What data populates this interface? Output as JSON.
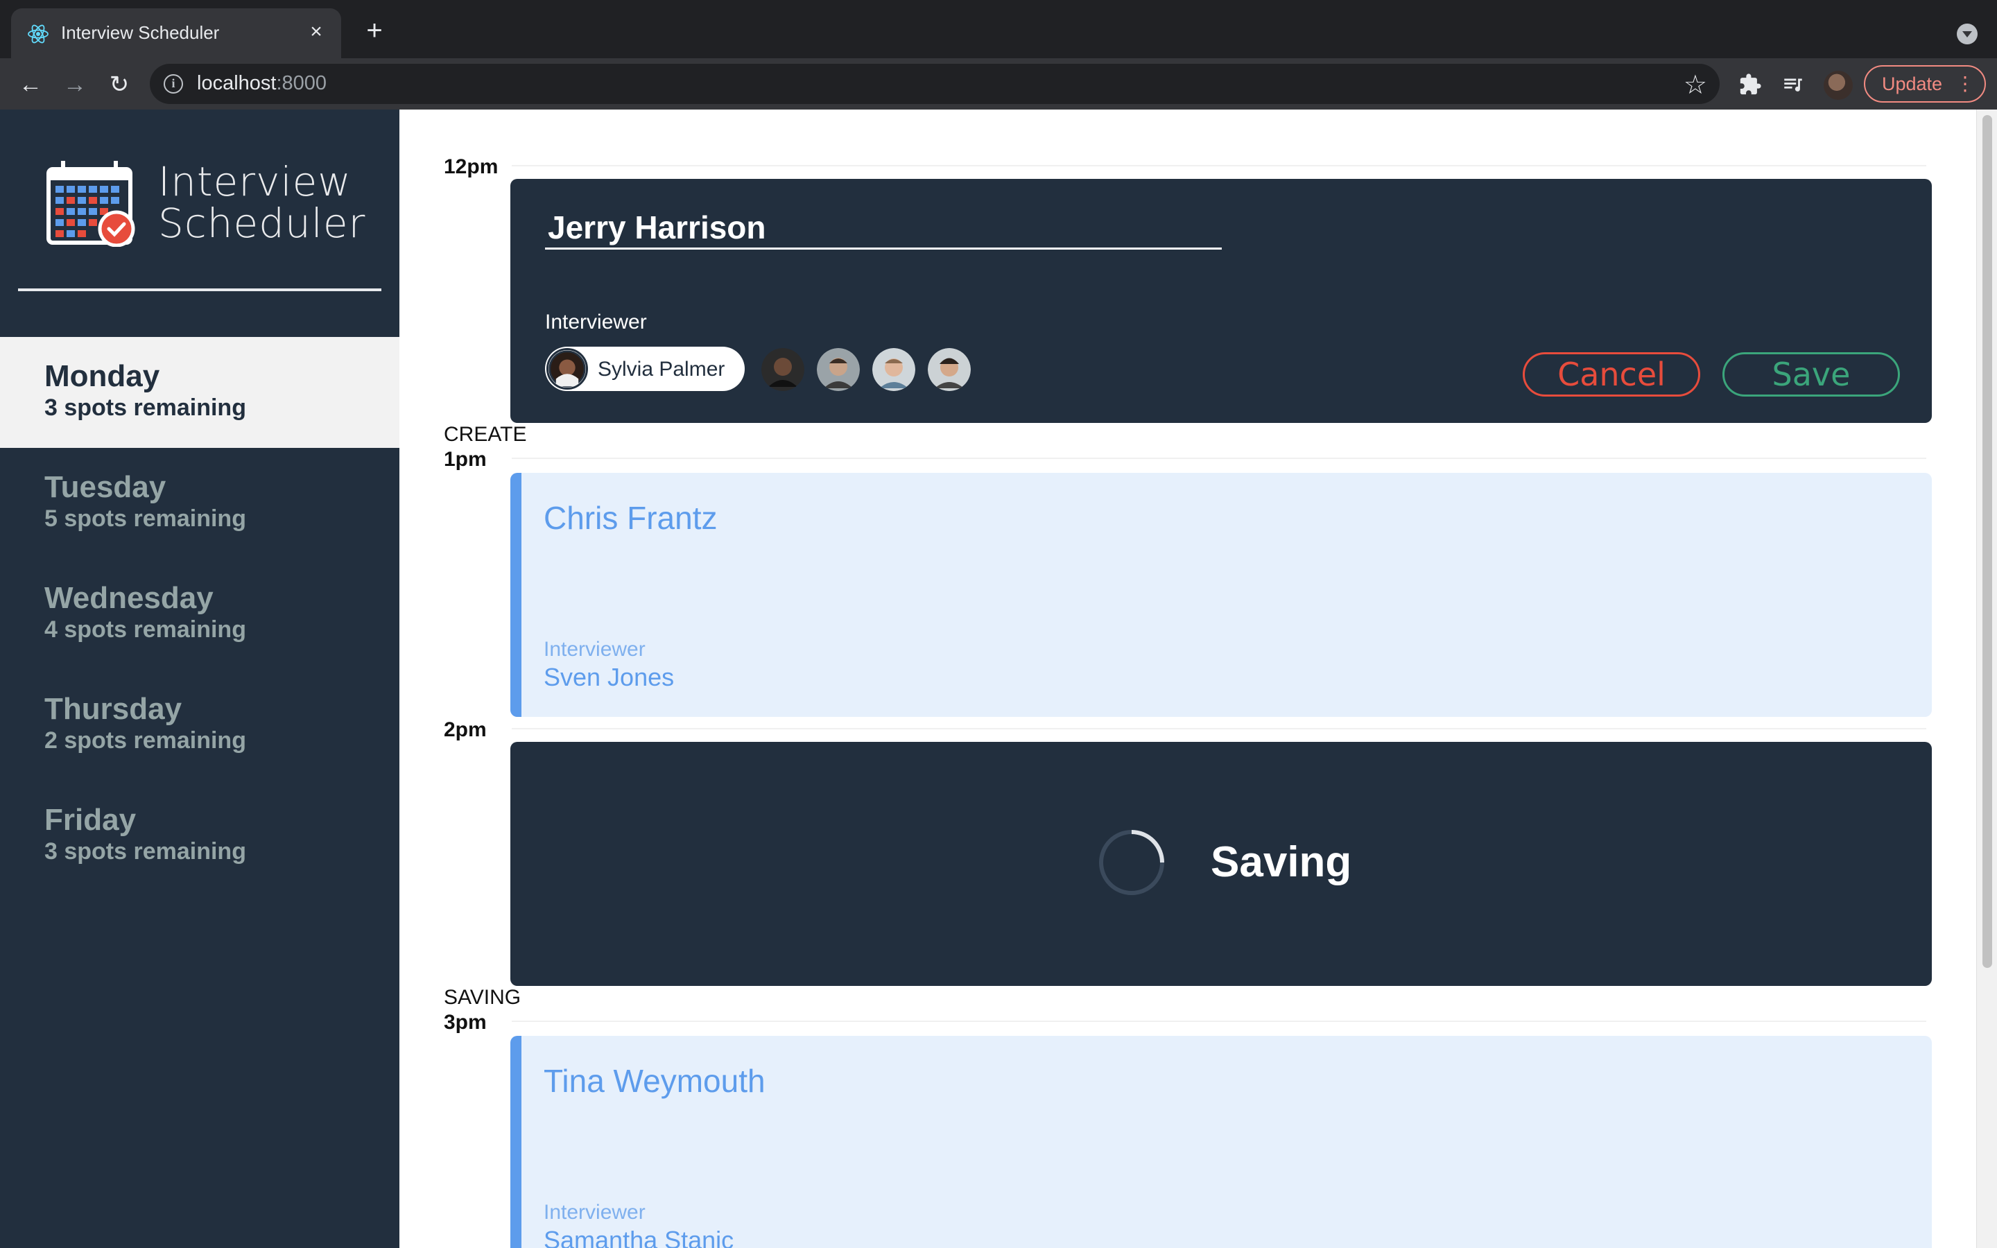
{
  "browser": {
    "tab_title": "Interview Scheduler",
    "tab_close": "×",
    "new_tab": "+",
    "url_host": "localhost",
    "url_port": ":8000",
    "update_label": "Update"
  },
  "sidebar": {
    "logo_line1": "Interview",
    "logo_line2": "Scheduler",
    "days": [
      {
        "name": "Monday",
        "spots": "3 spots remaining",
        "selected": true
      },
      {
        "name": "Tuesday",
        "spots": "5 spots remaining",
        "selected": false
      },
      {
        "name": "Wednesday",
        "spots": "4 spots remaining",
        "selected": false
      },
      {
        "name": "Thursday",
        "spots": "2 spots remaining",
        "selected": false
      },
      {
        "name": "Friday",
        "spots": "3 spots remaining",
        "selected": false
      }
    ]
  },
  "schedule": {
    "slots": [
      {
        "time": "12pm",
        "mode": ""
      },
      {
        "time": "1pm",
        "mode": "CREATE"
      },
      {
        "time": "2pm",
        "mode": ""
      },
      {
        "time": "3pm",
        "mode": "SAVING"
      }
    ],
    "form": {
      "student_name": "Jerry Harrison",
      "interviewer_title": "Interviewer",
      "selected_interviewer": "Sylvia Palmer",
      "cancel_label": "Cancel",
      "save_label": "Save"
    },
    "appointment_1": {
      "student": "Chris Frantz",
      "interviewer_title": "Interviewer",
      "interviewer": "Sven Jones"
    },
    "status": {
      "message": "Saving"
    },
    "appointment_2": {
      "student": "Tina Weymouth",
      "interviewer_title": "Interviewer",
      "interviewer": "Samantha Stanic"
    }
  },
  "colors": {
    "sidebar_bg": "#222f3e",
    "card_dark": "#222f3e",
    "card_light": "#e6f0fc",
    "accent_blue": "#5d9cec",
    "danger": "#e74c3c",
    "success": "#3ba57b"
  },
  "icons": [
    "react-icon",
    "close-icon",
    "plus-icon",
    "back-icon",
    "forward-icon",
    "reload-icon",
    "info-icon",
    "star-icon",
    "extensions-icon",
    "media-icon",
    "calendar-icon",
    "spinner-icon"
  ]
}
